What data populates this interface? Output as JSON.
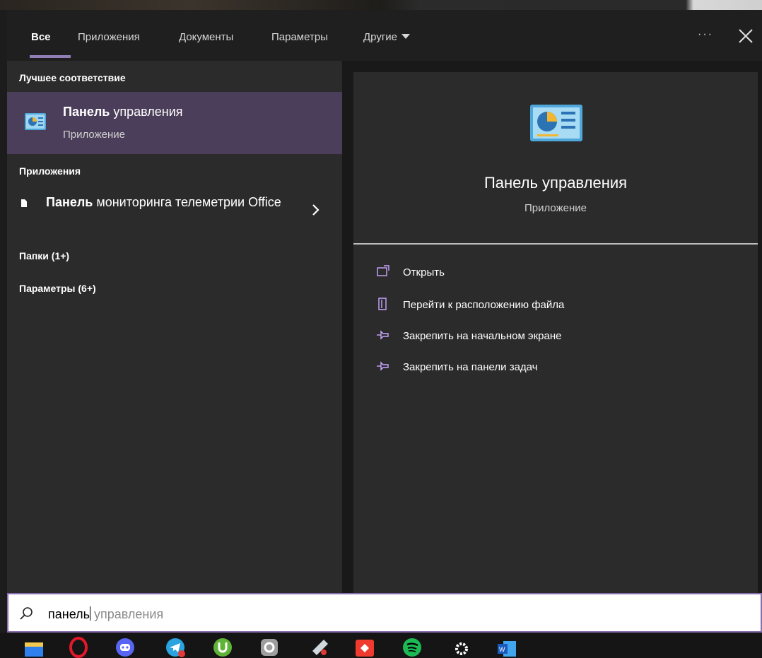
{
  "tabs": [
    {
      "label": "Все",
      "active": true
    },
    {
      "label": "Приложения",
      "active": false
    },
    {
      "label": "Документы",
      "active": false
    },
    {
      "label": "Параметры",
      "active": false
    },
    {
      "label": "Другие",
      "active": false
    }
  ],
  "header": {
    "more_label": "···",
    "close_icon": "close-icon"
  },
  "left": {
    "best_match_header": "Лучшее соответствие",
    "best_match": {
      "title_bold": "Панель",
      "title_rest": " управления",
      "subtitle": "Приложение",
      "icon": "control-panel-icon"
    },
    "apps_header": "Приложения",
    "app_item": {
      "title_bold": "Панель",
      "title_rest": " мониторинга телеметрии Office",
      "icon": "document-icon"
    },
    "folders_header": "Папки (1+)",
    "settings_header": "Параметры (6+)"
  },
  "preview": {
    "title": "Панель управления",
    "subtitle": "Приложение",
    "actions": [
      {
        "label": "Открыть",
        "icon": "open-icon"
      },
      {
        "label": "Перейти к расположению файла",
        "icon": "file-location-icon"
      },
      {
        "label": "Закрепить на начальном экране",
        "icon": "pin-icon"
      },
      {
        "label": "Закрепить на панели задач",
        "icon": "pin-icon"
      }
    ]
  },
  "search": {
    "typed": "панель",
    "suggestion": " управления"
  },
  "taskbar": {
    "icons": [
      "file-explorer-icon",
      "opera-icon",
      "discord-icon",
      "telegram-icon",
      "utorrent-icon",
      "app-icon",
      "paint-icon",
      "anydesk-icon",
      "spotify-icon",
      "settings-icon",
      "word-icon"
    ]
  },
  "colors": {
    "accent": "#8a6fb0",
    "selected_bg": "#4b3e5a",
    "pane_bg": "#2b2b2b"
  }
}
